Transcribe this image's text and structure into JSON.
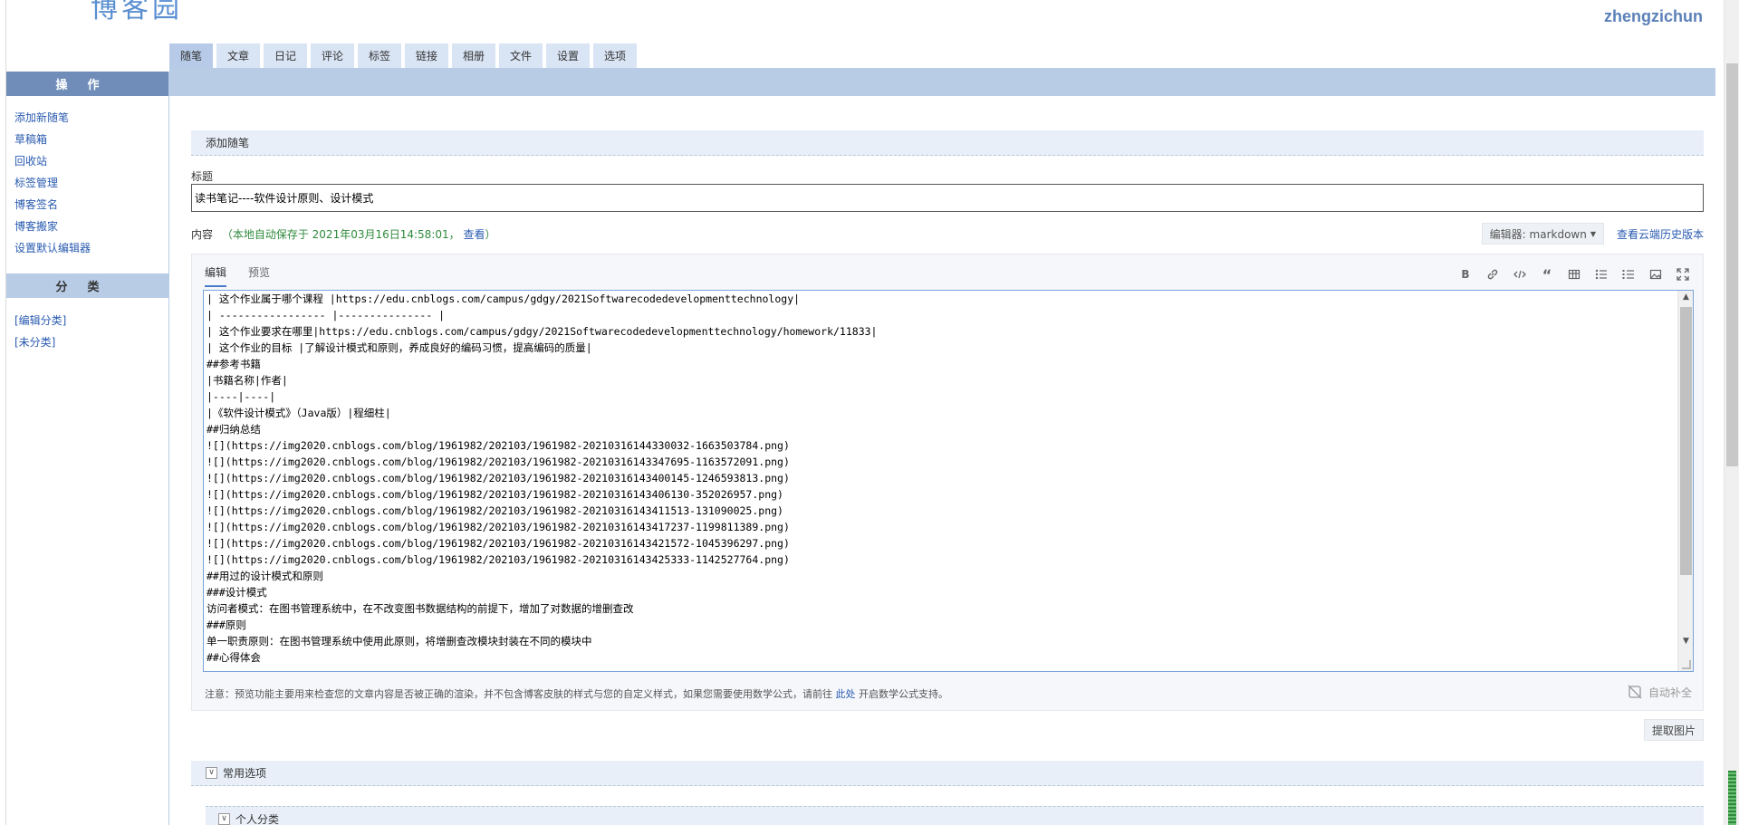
{
  "header": {
    "logo_text": "博客园",
    "username": "zhengzichun"
  },
  "tabs": [
    "随笔",
    "文章",
    "日记",
    "评论",
    "标签",
    "链接",
    "相册",
    "文件",
    "设置",
    "选项"
  ],
  "sidebar": {
    "ops_title": "操作",
    "links": [
      "添加新随笔",
      "草稿箱",
      "回收站",
      "标签管理",
      "博客签名",
      "博客搬家",
      "设置默认编辑器"
    ],
    "cat_title": "分类",
    "cats": [
      "[编辑分类]",
      "[未分类]"
    ]
  },
  "form": {
    "section_title": "添加随笔",
    "title_label": "标题",
    "title_value": "读书笔记----软件设计原则、设计模式",
    "content_label": "内容",
    "autosave_text": "（本地自动保存于 2021年03月16日14:58:01，",
    "autosave_view": "查看",
    "autosave_close": "）",
    "editor_select": "编辑器: markdown",
    "history_link": "查看云端历史版本",
    "tab_edit": "编辑",
    "tab_preview": "预览",
    "code_lines": [
      "| 这个作业属于哪个课程 |https://edu.cnblogs.com/campus/gdgy/2021Softwarecodedevelopmenttechnology|",
      "| ----------------- |--------------- |",
      "| 这个作业要求在哪里|https://edu.cnblogs.com/campus/gdgy/2021Softwarecodedevelopmenttechnology/homework/11833|",
      "| 这个作业的目标 |了解设计模式和原则，养成良好的编码习惯，提高编码的质量|",
      "##参考书籍",
      "|书籍名称|作者|",
      "|----|----|",
      "|《软件设计模式》（Java版）|程细柱|",
      "##归纳总结",
      "![](https://img2020.cnblogs.com/blog/1961982/202103/1961982-20210316144330032-1663503784.png)",
      "![](https://img2020.cnblogs.com/blog/1961982/202103/1961982-20210316143347695-1163572091.png)",
      "![](https://img2020.cnblogs.com/blog/1961982/202103/1961982-20210316143400145-1246593813.png)",
      "![](https://img2020.cnblogs.com/blog/1961982/202103/1961982-20210316143406130-352026957.png)",
      "![](https://img2020.cnblogs.com/blog/1961982/202103/1961982-20210316143411513-131090025.png)",
      "![](https://img2020.cnblogs.com/blog/1961982/202103/1961982-20210316143417237-1199811389.png)",
      "![](https://img2020.cnblogs.com/blog/1961982/202103/1961982-20210316143421572-1045396297.png)",
      "![](https://img2020.cnblogs.com/blog/1961982/202103/1961982-20210316143425333-1142527764.png)",
      "##用过的设计模式和原则",
      "###设计模式",
      "访问者模式：在图书管理系统中，在不改变图书数据结构的前提下，增加了对数据的增删查改",
      "###原则",
      "单一职责原则：在图书管理系统中使用此原则，将增删查改模块封装在不同的模块中",
      "##心得体会"
    ],
    "notice_text": "注意：预览功能主要用来检查您的文章内容是否被正确的渲染，并不包含博客皮肤的样式与您的自定义样式，如果您需要使用数学公式，请前往",
    "notice_link": "此处",
    "notice_tail": "开启数学公式支持。",
    "autocomplete": "自动补全",
    "extract_images": "提取图片",
    "common_options": "常用选项",
    "personal_category": "个人分类"
  }
}
